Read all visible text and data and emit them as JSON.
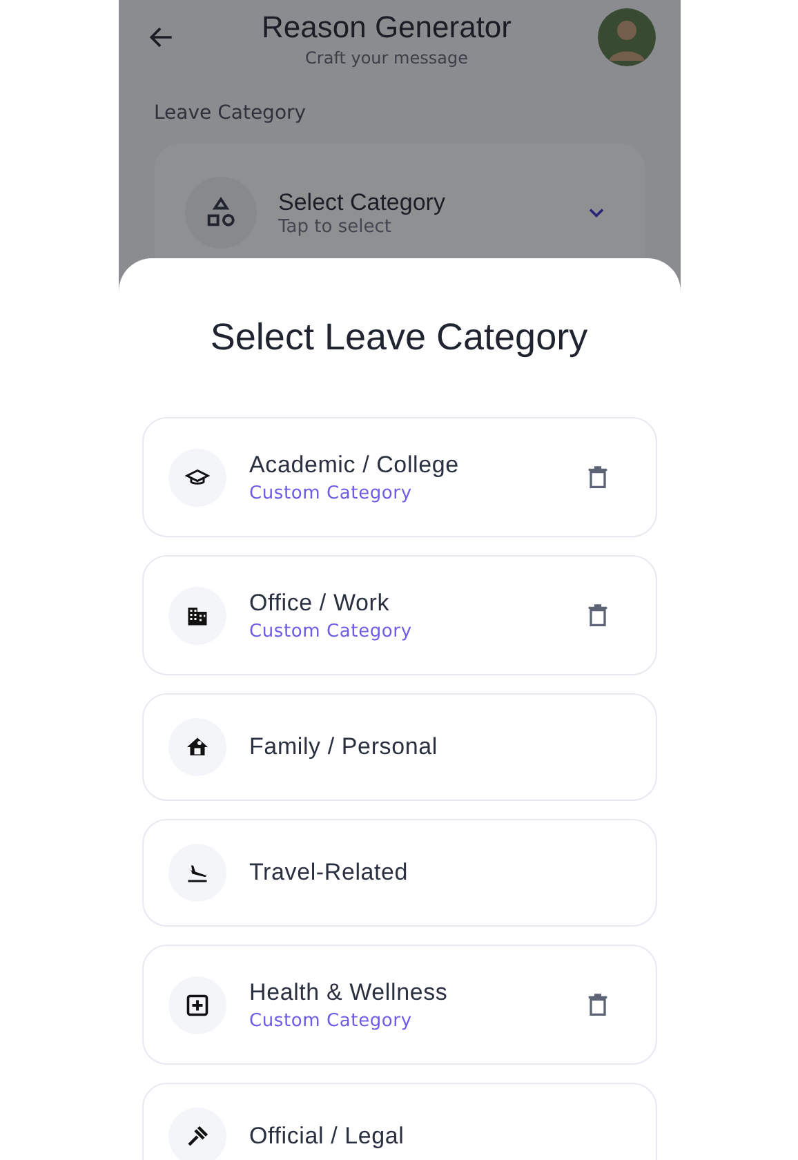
{
  "header": {
    "title": "Reason Generator",
    "subtitle": "Craft your message"
  },
  "field": {
    "label": "Leave Category",
    "value": "Select Category",
    "hint": "Tap to select"
  },
  "sheet": {
    "title": "Select Leave Category",
    "items": [
      {
        "title": "Academic / College",
        "subtitle": "Custom Category",
        "deletable": true
      },
      {
        "title": "Office / Work",
        "subtitle": "Custom Category",
        "deletable": true
      },
      {
        "title": "Family / Personal",
        "deletable": false
      },
      {
        "title": "Travel-Related",
        "deletable": false
      },
      {
        "title": "Health & Wellness",
        "subtitle": "Custom Category",
        "deletable": true
      },
      {
        "title": "Official / Legal",
        "deletable": false
      }
    ]
  }
}
